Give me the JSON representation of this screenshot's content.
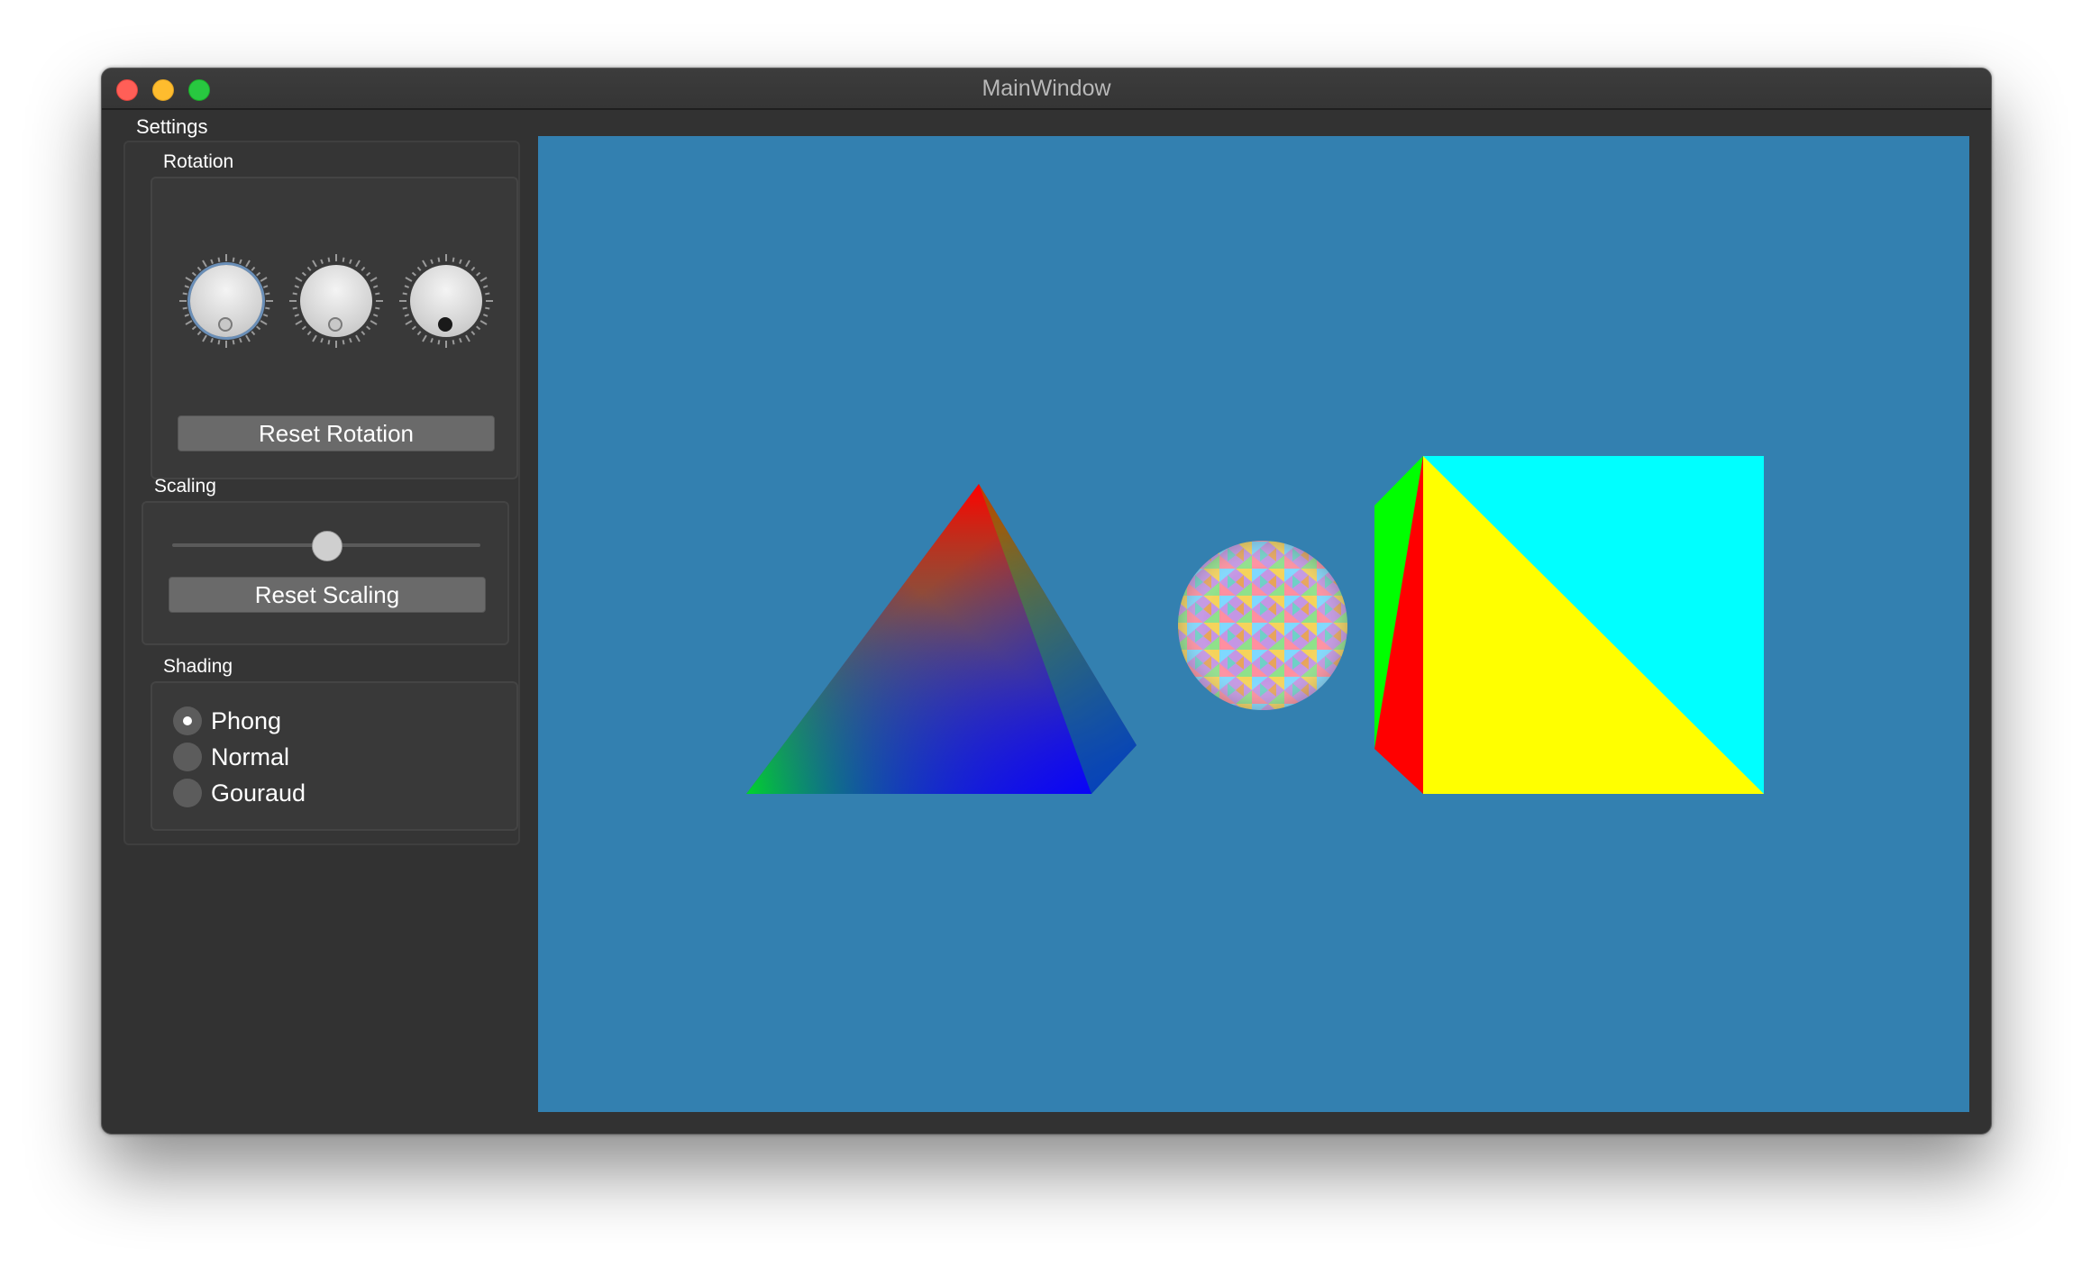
{
  "window": {
    "title": "MainWindow"
  },
  "sidebar": {
    "heading": "Settings",
    "rotation": {
      "label": "Rotation",
      "dials": [
        {
          "name": "rotation-x",
          "active": true
        },
        {
          "name": "rotation-y",
          "active": false
        },
        {
          "name": "rotation-z",
          "active": false
        }
      ],
      "reset_label": "Reset Rotation"
    },
    "scaling": {
      "label": "Scaling",
      "slider_value": 0.5,
      "reset_label": "Reset Scaling"
    },
    "shading": {
      "label": "Shading",
      "options": [
        "Phong",
        "Normal",
        "Gouraud"
      ],
      "selected": "Phong"
    }
  },
  "viewport": {
    "background": "#3380b0",
    "objects": [
      "pyramid",
      "sphere",
      "cube"
    ]
  }
}
